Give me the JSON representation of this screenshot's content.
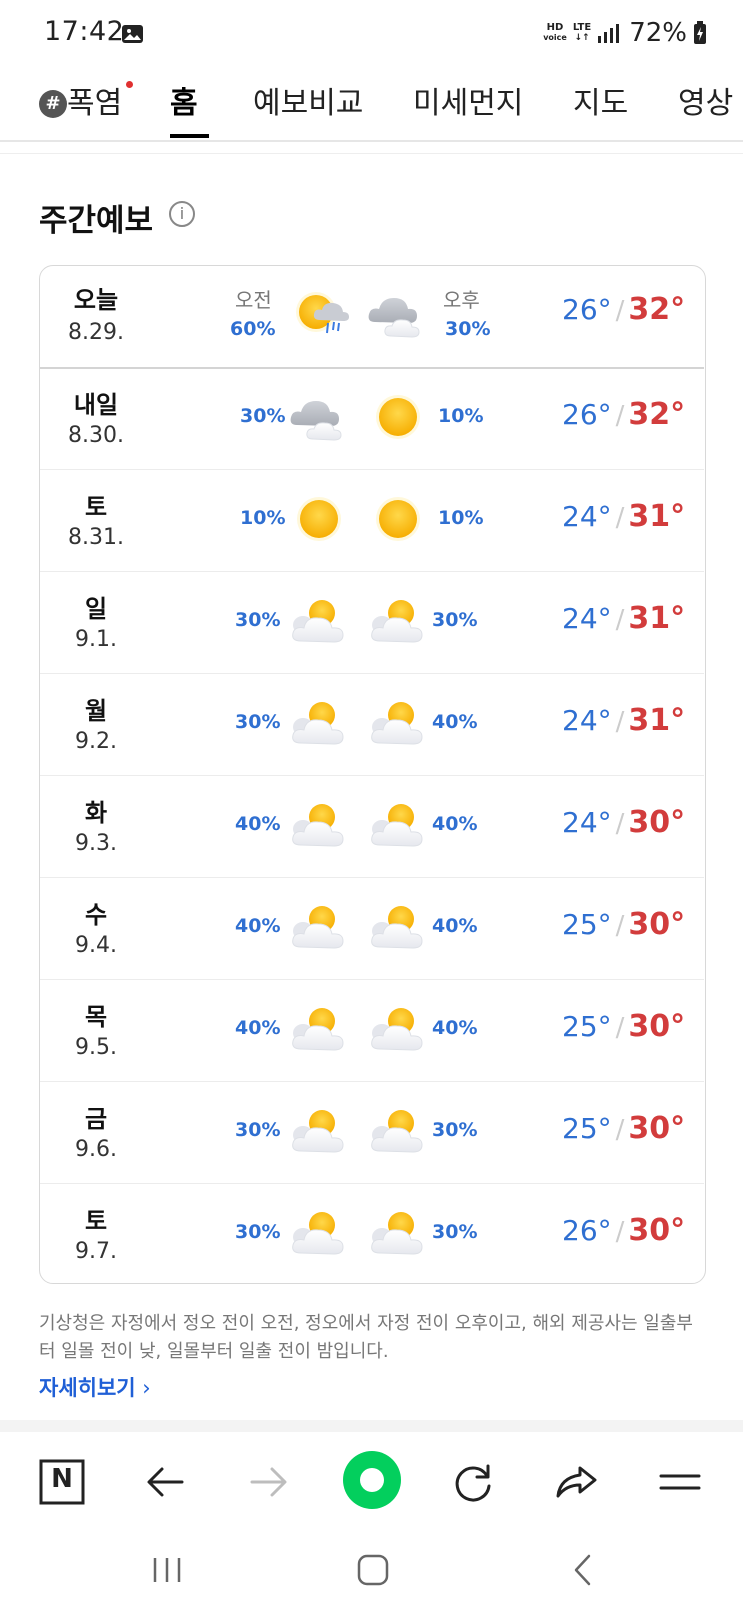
{
  "status": {
    "time": "17:42",
    "hd": "HD",
    "hd_sub": "voice",
    "lte": "LTE",
    "battery": "72%"
  },
  "nav": {
    "tabs": [
      {
        "label": "폭염"
      },
      {
        "label": "홈"
      },
      {
        "label": "예보비교"
      },
      {
        "label": "미세먼지"
      },
      {
        "label": "지도"
      },
      {
        "label": "영상"
      }
    ]
  },
  "section": {
    "title": "주간예보",
    "info_glyph": "i"
  },
  "today_labels": {
    "am": "오전",
    "pm": "오후"
  },
  "forecast": [
    {
      "day": "오늘",
      "date": "8.29.",
      "am_pct": "60%",
      "pm_pct": "30%",
      "am_icon": "sun-rain-icon",
      "pm_icon": "cloudy-icon",
      "low": "26°",
      "high": "32°"
    },
    {
      "day": "내일",
      "date": "8.30.",
      "am_pct": "30%",
      "pm_pct": "10%",
      "am_icon": "cloudy-icon",
      "pm_icon": "sunny-icon",
      "low": "26°",
      "high": "32°"
    },
    {
      "day": "토",
      "date": "8.31.",
      "am_pct": "10%",
      "pm_pct": "10%",
      "am_icon": "sunny-icon",
      "pm_icon": "sunny-icon",
      "low": "24°",
      "high": "31°"
    },
    {
      "day": "일",
      "date": "9.1.",
      "am_pct": "30%",
      "pm_pct": "30%",
      "am_icon": "partly-cloudy-icon",
      "pm_icon": "partly-cloudy-icon",
      "low": "24°",
      "high": "31°"
    },
    {
      "day": "월",
      "date": "9.2.",
      "am_pct": "30%",
      "pm_pct": "40%",
      "am_icon": "partly-cloudy-icon",
      "pm_icon": "partly-cloudy-icon",
      "low": "24°",
      "high": "31°"
    },
    {
      "day": "화",
      "date": "9.3.",
      "am_pct": "40%",
      "pm_pct": "40%",
      "am_icon": "partly-cloudy-icon",
      "pm_icon": "partly-cloudy-icon",
      "low": "24°",
      "high": "30°"
    },
    {
      "day": "수",
      "date": "9.4.",
      "am_pct": "40%",
      "pm_pct": "40%",
      "am_icon": "partly-cloudy-icon",
      "pm_icon": "partly-cloudy-icon",
      "low": "25°",
      "high": "30°"
    },
    {
      "day": "목",
      "date": "9.5.",
      "am_pct": "40%",
      "pm_pct": "40%",
      "am_icon": "partly-cloudy-icon",
      "pm_icon": "partly-cloudy-icon",
      "low": "25°",
      "high": "30°"
    },
    {
      "day": "금",
      "date": "9.6.",
      "am_pct": "30%",
      "pm_pct": "30%",
      "am_icon": "partly-cloudy-icon",
      "pm_icon": "partly-cloudy-icon",
      "low": "25°",
      "high": "30°"
    },
    {
      "day": "토",
      "date": "9.7.",
      "am_pct": "30%",
      "pm_pct": "30%",
      "am_icon": "partly-cloudy-icon",
      "pm_icon": "partly-cloudy-icon",
      "low": "26°",
      "high": "30°"
    }
  ],
  "note": "기상청은 자정에서 정오 전이 오전, 정오에서 자정 전이 오후이고, 해외 제공사는 일출부터 일몰 전이 낮, 일몰부터 일출 전이 밤입니다.",
  "more_link": "자세히보기",
  "toolbar": {
    "naver_glyph": "N",
    "icons": [
      "naver-home-icon",
      "back-arrow-icon",
      "forward-arrow-icon",
      "green-dot-icon",
      "reload-icon",
      "share-icon",
      "menu-icon"
    ]
  },
  "colors": {
    "low_temp": "#2f6fd1",
    "high_temp": "#d23c3c",
    "precip": "#2f6fd1",
    "link": "#1f5fd6",
    "green_button": "#03cf5d"
  }
}
